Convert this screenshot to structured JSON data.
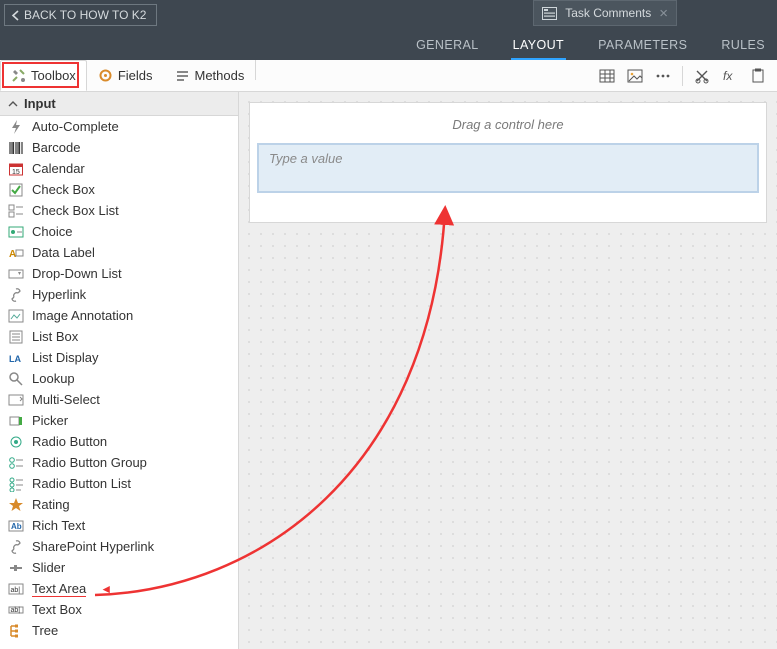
{
  "header": {
    "back_label": "BACK TO HOW TO K2",
    "tab_title": "Task Comments",
    "nav": [
      "GENERAL",
      "LAYOUT",
      "PARAMETERS",
      "RULES"
    ],
    "nav_active_index": 1
  },
  "left_tabs": {
    "toolbox": "Toolbox",
    "fields": "Fields",
    "methods": "Methods",
    "active": "toolbox"
  },
  "category": {
    "label": "Input"
  },
  "controls": [
    {
      "icon": "bolt",
      "label": "Auto-Complete"
    },
    {
      "icon": "barcode",
      "label": "Barcode"
    },
    {
      "icon": "calendar",
      "label": "Calendar"
    },
    {
      "icon": "checkbox",
      "label": "Check Box"
    },
    {
      "icon": "checkboxlist",
      "label": "Check Box List"
    },
    {
      "icon": "choice",
      "label": "Choice"
    },
    {
      "icon": "datalabel",
      "label": "Data Label"
    },
    {
      "icon": "dropdown",
      "label": "Drop-Down List"
    },
    {
      "icon": "link",
      "label": "Hyperlink"
    },
    {
      "icon": "imganno",
      "label": "Image Annotation"
    },
    {
      "icon": "listbox",
      "label": "List Box"
    },
    {
      "icon": "listdisplay",
      "label": "List Display"
    },
    {
      "icon": "search",
      "label": "Lookup"
    },
    {
      "icon": "multiselect",
      "label": "Multi-Select"
    },
    {
      "icon": "picker",
      "label": "Picker"
    },
    {
      "icon": "radio",
      "label": "Radio Button"
    },
    {
      "icon": "radiogroup",
      "label": "Radio Button Group"
    },
    {
      "icon": "radiolist",
      "label": "Radio Button List"
    },
    {
      "icon": "star",
      "label": "Rating"
    },
    {
      "icon": "richtext",
      "label": "Rich Text"
    },
    {
      "icon": "link",
      "label": "SharePoint Hyperlink"
    },
    {
      "icon": "slider",
      "label": "Slider"
    },
    {
      "icon": "textarea",
      "label": "Text Area",
      "highlight": true
    },
    {
      "icon": "textbox",
      "label": "Text Box"
    },
    {
      "icon": "tree",
      "label": "Tree"
    }
  ],
  "canvas": {
    "drop_hint": "Drag a control here",
    "textarea_placeholder": "Type a value"
  }
}
